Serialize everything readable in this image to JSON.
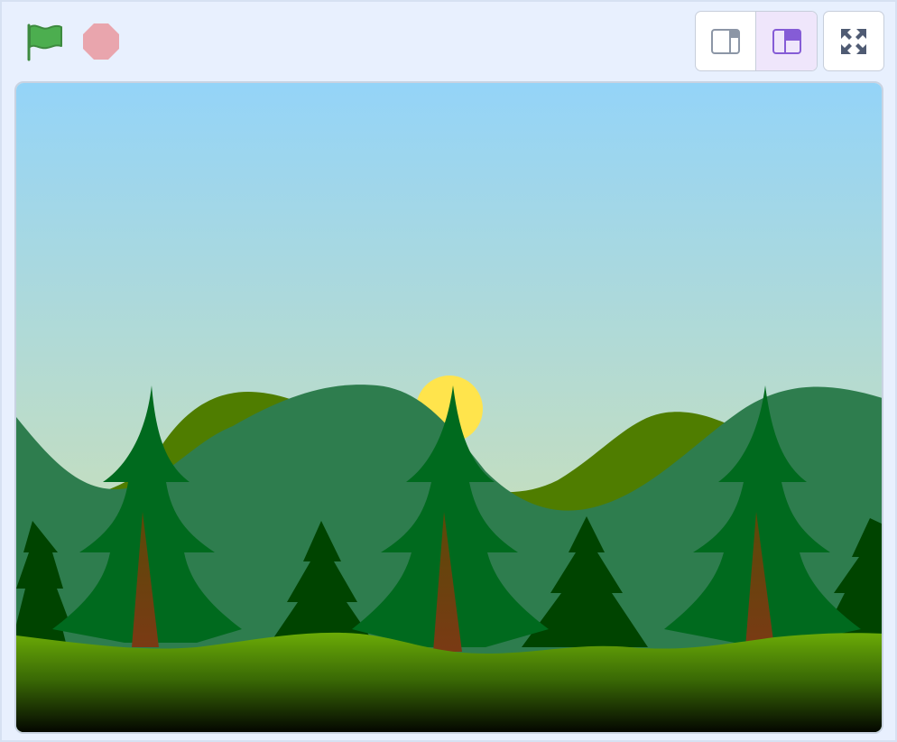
{
  "toolbar": {
    "green_flag": {
      "icon": "green-flag-icon",
      "color": "#4cae4f"
    },
    "stop": {
      "icon": "stop-octagon-icon",
      "color": "#e9a5ad"
    },
    "stage_modes": [
      {
        "name": "small-stage",
        "icon": "small-stage-icon",
        "active": false
      },
      {
        "name": "normal-stage",
        "icon": "normal-stage-icon",
        "active": true
      }
    ],
    "fullscreen": {
      "icon": "fullscreen-icon"
    }
  },
  "stage": {
    "backdrop": "forest",
    "colors": {
      "sky_top": "#94d4f8",
      "sky_bottom": "#dde3a2",
      "sun": "#ffe44c",
      "back_hills": "#4f7d00",
      "mid_hills": "#2e7d4e",
      "ground_top": "#6bab07",
      "ground_bottom": "#000000",
      "tree_light": "#006a1e",
      "tree_dark": "#004400",
      "trunk": "#6b3e10"
    }
  }
}
